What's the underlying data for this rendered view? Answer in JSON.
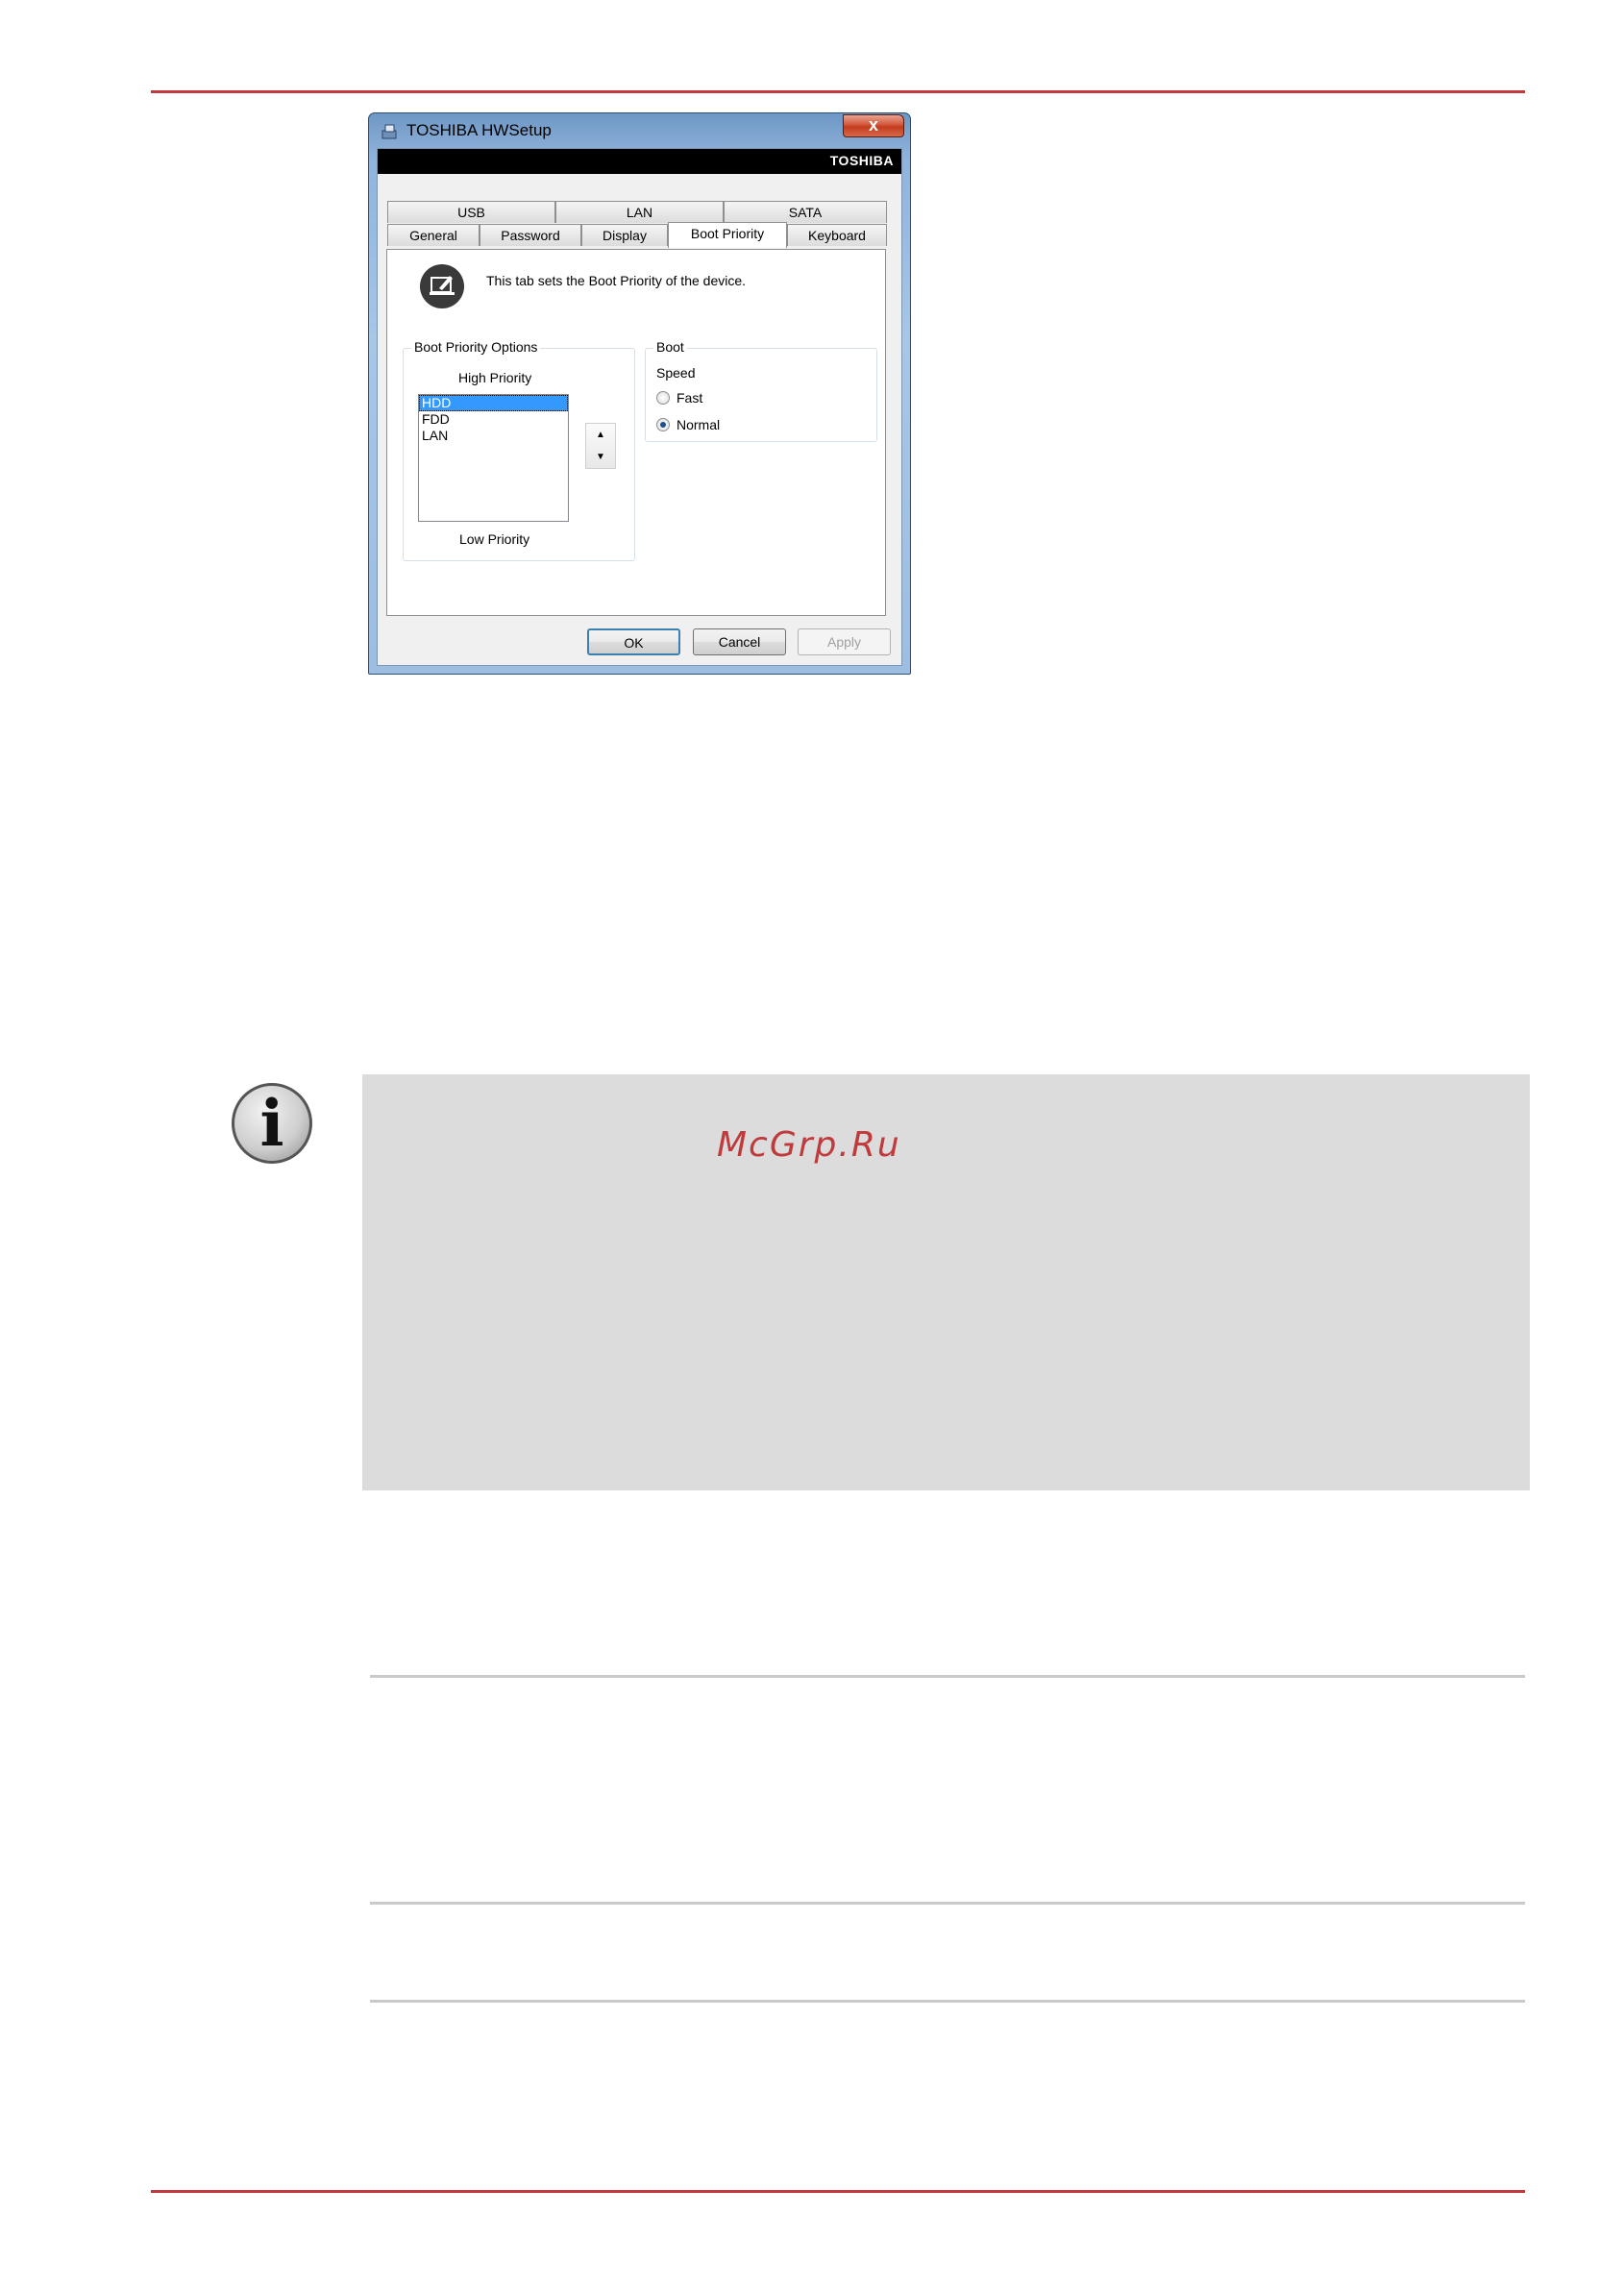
{
  "window": {
    "title": "TOSHIBA HWSetup",
    "close_label": "x",
    "brand": "TOSHIBA"
  },
  "tabs": {
    "row1": [
      "USB",
      "LAN",
      "SATA"
    ],
    "row2": [
      "General",
      "Password",
      "Display",
      "Boot Priority",
      "Keyboard"
    ],
    "active": "Boot Priority"
  },
  "panel": {
    "description": "This tab sets the Boot Priority of the device.",
    "boot_priority_options": {
      "group_label": "Boot Priority Options",
      "high_label": "High Priority",
      "low_label": "Low Priority",
      "items": [
        "HDD",
        "FDD",
        "LAN"
      ],
      "selected": "HDD",
      "up_glyph": "▲",
      "down_glyph": "▼"
    },
    "boot_speed": {
      "group_label": "Boot",
      "speed_label": "Speed",
      "options": [
        "Fast",
        "Normal"
      ],
      "selected": "Normal"
    }
  },
  "buttons": {
    "ok": "OK",
    "cancel": "Cancel",
    "apply": "Apply"
  },
  "note": {
    "watermark": "McGrp.Ru",
    "icon_glyph": "i"
  },
  "colors": {
    "accent_rule": "#c0393b",
    "note_background": "#dcdcdc",
    "selection": "#3399ff"
  }
}
